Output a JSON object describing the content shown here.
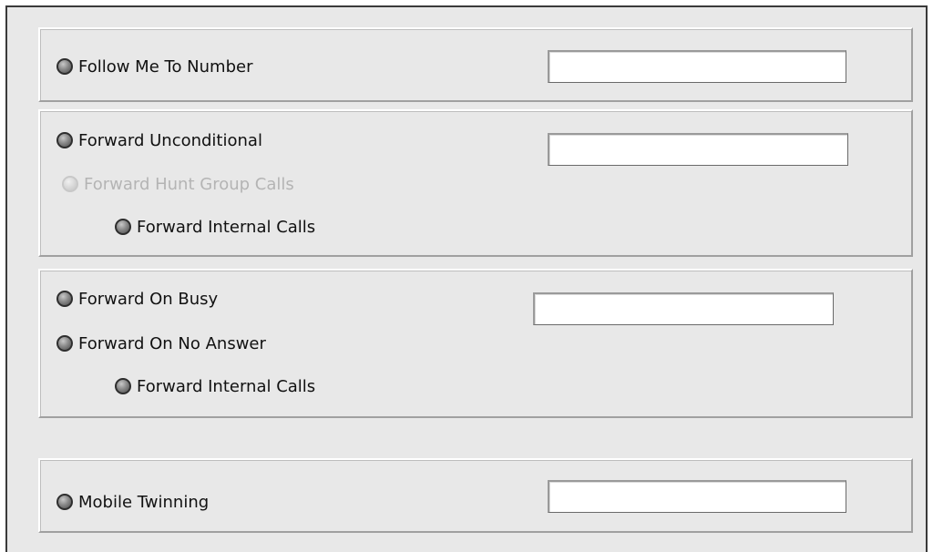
{
  "follow_me": {
    "label": "Follow Me To Number",
    "number_value": ""
  },
  "forward_unconditional": {
    "label": "Forward Unconditional",
    "number_value": "",
    "hunt_group_label": "Forward Hunt Group Calls",
    "internal_calls_label": "Forward Internal Calls"
  },
  "forward_busy_no_answer": {
    "busy_label": "Forward On Busy",
    "no_answer_label": "Forward On No Answer",
    "number_value": "",
    "internal_calls_label": "Forward Internal Calls"
  },
  "mobile_twinning": {
    "label": "Mobile Twinning",
    "number_value": ""
  }
}
